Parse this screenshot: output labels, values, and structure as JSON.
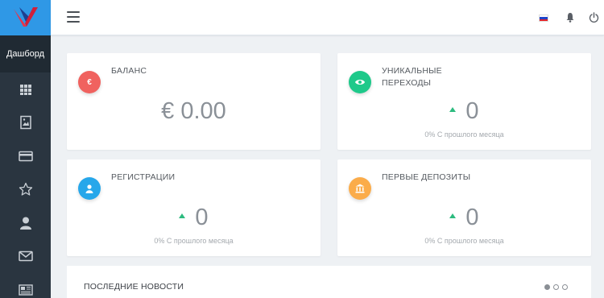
{
  "sidebar": {
    "dashboard_label": "Дашборд",
    "icons": [
      "grid-icon",
      "image-icon",
      "card-icon",
      "star-icon",
      "user-icon",
      "mail-icon",
      "news-icon"
    ]
  },
  "cards": {
    "balance": {
      "title": "БАЛАНС",
      "value": "€ 0.00",
      "icon_symbol": "€",
      "color": "#f0625f"
    },
    "unique": {
      "title": "УНИКАЛЬНЫЕ ПЕРЕХОДЫ",
      "value": "0",
      "sub": "0% С прошлого месяца",
      "color": "#1ec98a"
    },
    "registrations": {
      "title": "РЕГИСТРАЦИИ",
      "value": "0",
      "sub": "0% С прошлого месяца",
      "color": "#27a7ea"
    },
    "deposits": {
      "title": "ПЕРВЫЕ ДЕПОЗИТЫ",
      "value": "0",
      "sub": "0% С прошлого месяца",
      "color": "#fbac4a"
    }
  },
  "news": {
    "title": "ПОСЛЕДНИЕ НОВОСТИ"
  },
  "colors": {
    "sidebar": "#202a33",
    "accent": "#2f98e6",
    "up": "#2dbb7f"
  }
}
